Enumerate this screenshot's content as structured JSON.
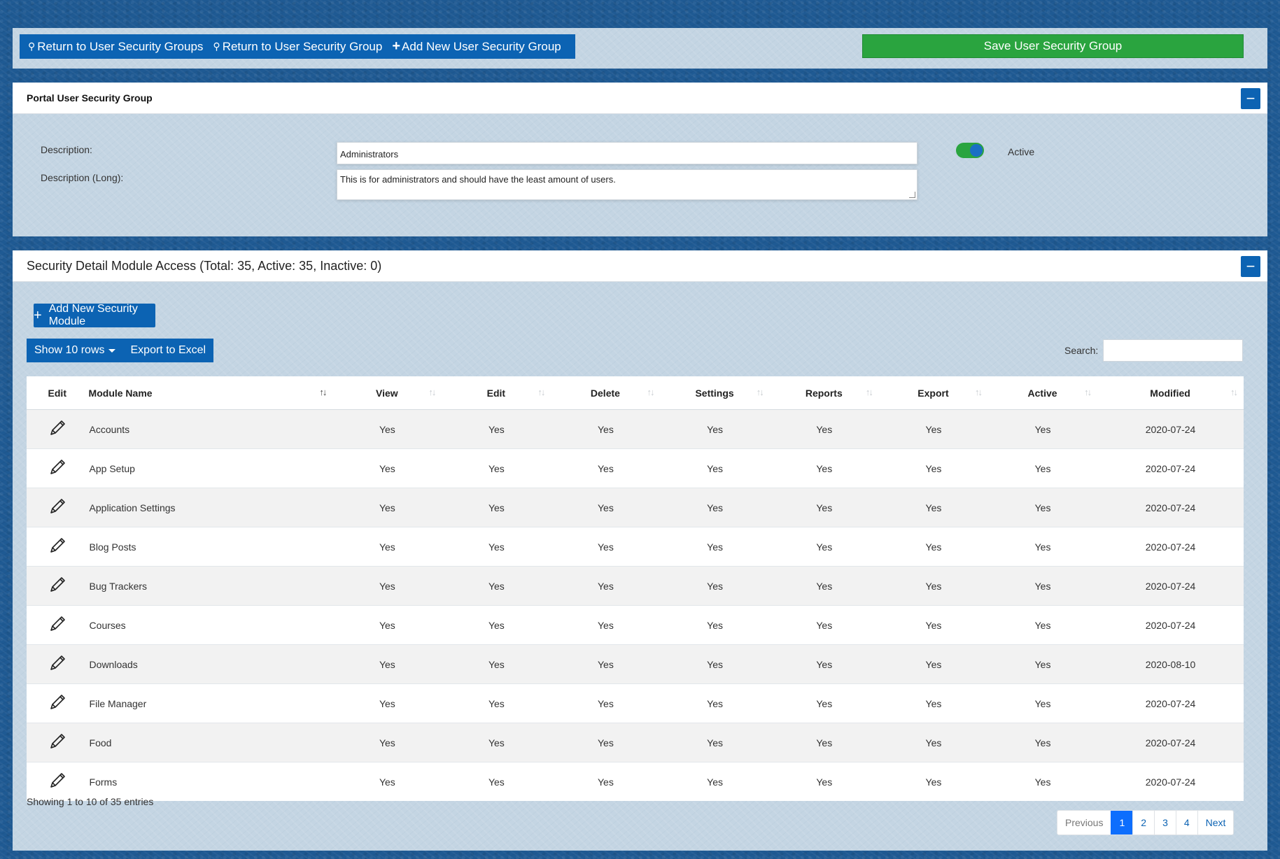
{
  "toolbar": {
    "return_groups_label": "Return to User Security Groups",
    "return_group_label": "Return to User Security Group",
    "add_group_label": "Add New User Security Group",
    "save_label": "Save User Security Group"
  },
  "group_panel": {
    "title": "Portal User Security Group",
    "collapse_symbol": "−",
    "description_label": "Description:",
    "description_long_label": "Description (Long):",
    "description_value": "Administrators",
    "description_long_value": "This is for administrators and should have the least amount of users.",
    "active_label": "Active",
    "active": true
  },
  "module_panel": {
    "title": "Security Detail Module Access (Total: 35, Active: 35, Inactive: 0)",
    "collapse_symbol": "−",
    "add_module_label": "Add New Security Module",
    "show_rows_label": "Show 10 rows",
    "export_label": "Export to Excel",
    "search_label": "Search:",
    "search_value": "",
    "columns": [
      "Edit",
      "Module Name",
      "View",
      "Edit",
      "Delete",
      "Settings",
      "Reports",
      "Export",
      "Active",
      "Modified"
    ],
    "rows": [
      {
        "name": "Accounts",
        "view": "Yes",
        "edit": "Yes",
        "delete": "Yes",
        "settings": "Yes",
        "reports": "Yes",
        "export": "Yes",
        "active": "Yes",
        "modified": "2020-07-24"
      },
      {
        "name": "App Setup",
        "view": "Yes",
        "edit": "Yes",
        "delete": "Yes",
        "settings": "Yes",
        "reports": "Yes",
        "export": "Yes",
        "active": "Yes",
        "modified": "2020-07-24"
      },
      {
        "name": "Application Settings",
        "view": "Yes",
        "edit": "Yes",
        "delete": "Yes",
        "settings": "Yes",
        "reports": "Yes",
        "export": "Yes",
        "active": "Yes",
        "modified": "2020-07-24"
      },
      {
        "name": "Blog Posts",
        "view": "Yes",
        "edit": "Yes",
        "delete": "Yes",
        "settings": "Yes",
        "reports": "Yes",
        "export": "Yes",
        "active": "Yes",
        "modified": "2020-07-24"
      },
      {
        "name": "Bug Trackers",
        "view": "Yes",
        "edit": "Yes",
        "delete": "Yes",
        "settings": "Yes",
        "reports": "Yes",
        "export": "Yes",
        "active": "Yes",
        "modified": "2020-07-24"
      },
      {
        "name": "Courses",
        "view": "Yes",
        "edit": "Yes",
        "delete": "Yes",
        "settings": "Yes",
        "reports": "Yes",
        "export": "Yes",
        "active": "Yes",
        "modified": "2020-07-24"
      },
      {
        "name": "Downloads",
        "view": "Yes",
        "edit": "Yes",
        "delete": "Yes",
        "settings": "Yes",
        "reports": "Yes",
        "export": "Yes",
        "active": "Yes",
        "modified": "2020-08-10"
      },
      {
        "name": "File Manager",
        "view": "Yes",
        "edit": "Yes",
        "delete": "Yes",
        "settings": "Yes",
        "reports": "Yes",
        "export": "Yes",
        "active": "Yes",
        "modified": "2020-07-24"
      },
      {
        "name": "Food",
        "view": "Yes",
        "edit": "Yes",
        "delete": "Yes",
        "settings": "Yes",
        "reports": "Yes",
        "export": "Yes",
        "active": "Yes",
        "modified": "2020-07-24"
      },
      {
        "name": "Forms",
        "view": "Yes",
        "edit": "Yes",
        "delete": "Yes",
        "settings": "Yes",
        "reports": "Yes",
        "export": "Yes",
        "active": "Yes",
        "modified": "2020-07-24"
      }
    ],
    "showing_text": "Showing 1 to 10 of 35 entries",
    "pagination": {
      "previous": "Previous",
      "pages": [
        "1",
        "2",
        "3",
        "4"
      ],
      "current": "1",
      "next": "Next"
    }
  },
  "colors": {
    "primary": "#0c63b3",
    "success": "#2aa43f",
    "page_bg": "#1f5a93",
    "panel_bg": "#c4d5e3"
  }
}
